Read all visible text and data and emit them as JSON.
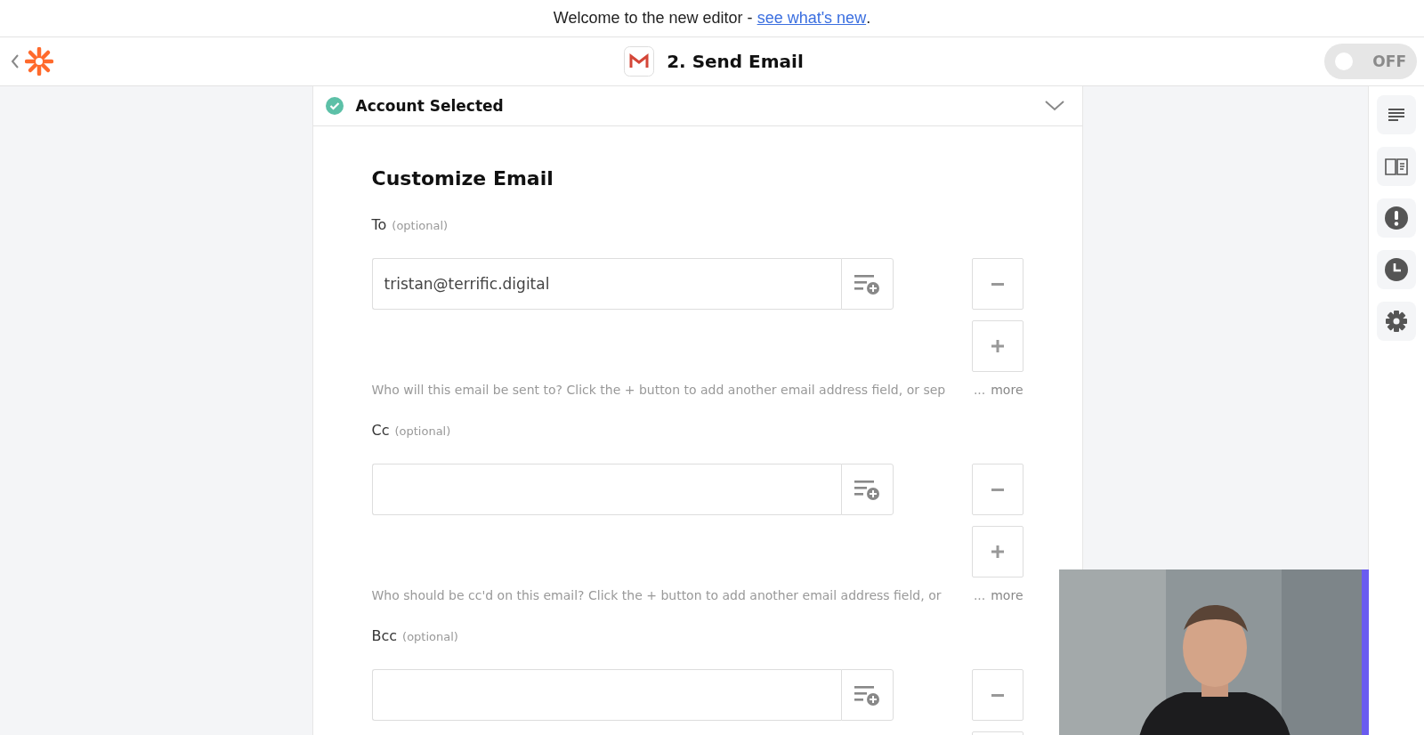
{
  "banner": {
    "text": "Welcome to the new editor - ",
    "link": "see what's new",
    "end": "."
  },
  "header": {
    "title": "2. Send Email",
    "toggle": {
      "label": "OFF",
      "on": false
    }
  },
  "account": {
    "title": "Account Selected",
    "done": true
  },
  "section_title": "Customize Email",
  "fields": [
    {
      "label": "To",
      "hint": "(optional)",
      "value": "tristan@terrific.digital",
      "help": "Who will this email be sent to? Click the + button to add another email address field, or sep",
      "ellipsis": "...",
      "more": "more"
    },
    {
      "label": "Cc",
      "hint": "(optional)",
      "help": "Who should be cc'd on this email? Click the + button to add another email address field, or",
      "ellipsis": "...",
      "more": "more"
    },
    {
      "label": "Bcc",
      "hint": "(optional)"
    }
  ]
}
